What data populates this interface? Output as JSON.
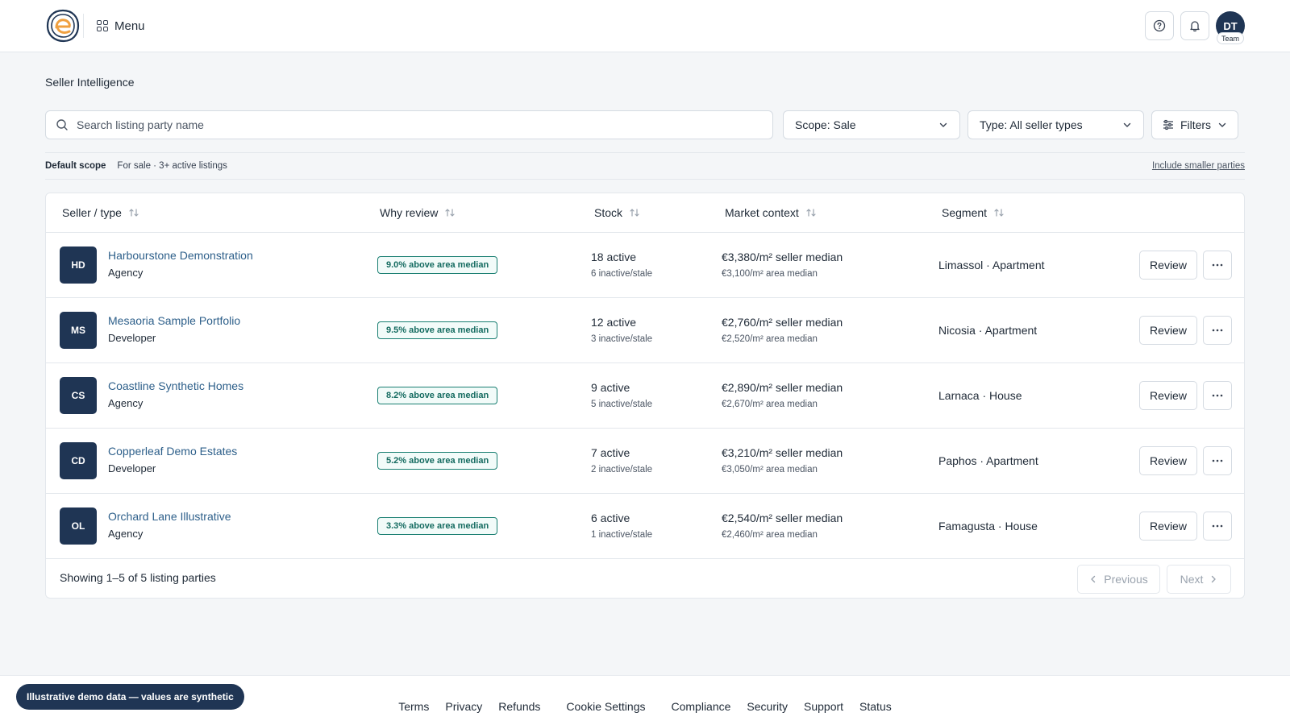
{
  "header": {
    "menu_label": "Menu",
    "avatar_initials": "DT",
    "avatar_badge": "Team"
  },
  "page": {
    "title": "Seller Intelligence"
  },
  "search": {
    "placeholder": "Search listing party name",
    "value": ""
  },
  "filters": {
    "scope_label": "Scope: Sale",
    "type_label": "Type: All seller types",
    "filters_label": "Filters"
  },
  "scope_bar": {
    "key": "Default scope",
    "value": "For sale · 3+ active listings",
    "link": "Include smaller parties"
  },
  "table": {
    "columns": [
      "Seller / type",
      "Why review",
      "Stock",
      "Market context",
      "Segment"
    ],
    "rows": [
      {
        "initials": "HD",
        "name": "Harbourstone Demonstration",
        "type": "Agency",
        "why": "9.0% above area median",
        "active": "18 active",
        "inactive": "6 inactive/stale",
        "seller_median": "€3,380/m² seller median",
        "area_median": "€3,100/m² area median",
        "segment": "Limassol · Apartment",
        "action": "Review"
      },
      {
        "initials": "MS",
        "name": "Mesaoria Sample Portfolio",
        "type": "Developer",
        "why": "9.5% above area median",
        "active": "12 active",
        "inactive": "3 inactive/stale",
        "seller_median": "€2,760/m² seller median",
        "area_median": "€2,520/m² area median",
        "segment": "Nicosia · Apartment",
        "action": "Review"
      },
      {
        "initials": "CS",
        "name": "Coastline Synthetic Homes",
        "type": "Agency",
        "why": "8.2% above area median",
        "active": "9 active",
        "inactive": "5 inactive/stale",
        "seller_median": "€2,890/m² seller median",
        "area_median": "€2,670/m² area median",
        "segment": "Larnaca · House",
        "action": "Review"
      },
      {
        "initials": "CD",
        "name": "Copperleaf Demo Estates",
        "type": "Developer",
        "why": "5.2% above area median",
        "active": "7 active",
        "inactive": "2 inactive/stale",
        "seller_median": "€3,210/m² seller median",
        "area_median": "€3,050/m² area median",
        "segment": "Paphos · Apartment",
        "action": "Review"
      },
      {
        "initials": "OL",
        "name": "Orchard Lane Illustrative",
        "type": "Agency",
        "why": "3.3% above area median",
        "active": "6 active",
        "inactive": "1 inactive/stale",
        "seller_median": "€2,540/m² seller median",
        "area_median": "€2,460/m² area median",
        "segment": "Famagusta · House",
        "action": "Review"
      }
    ],
    "footer_text": "Showing 1–5 of 5 listing parties",
    "prev_label": "Previous",
    "next_label": "Next"
  },
  "footer": {
    "links": [
      "Terms",
      "Privacy",
      "Refunds",
      "Cookie Settings",
      "Compliance",
      "Security",
      "Support",
      "Status"
    ]
  },
  "demo_badge": "Illustrative demo data — values are synthetic",
  "colors": {
    "brand_navy": "#1f3554",
    "link_blue": "#2d5f8a",
    "pill_teal": "#1a7f72",
    "logo_orange": "#f0a040"
  },
  "icons": {
    "help": "question-circle-icon",
    "bell": "bell-icon",
    "search": "search-icon",
    "chevron": "chevron-down-icon",
    "filters": "sliders-icon",
    "sort": "sort-arrows-icon",
    "more": "more-horizontal-icon"
  }
}
